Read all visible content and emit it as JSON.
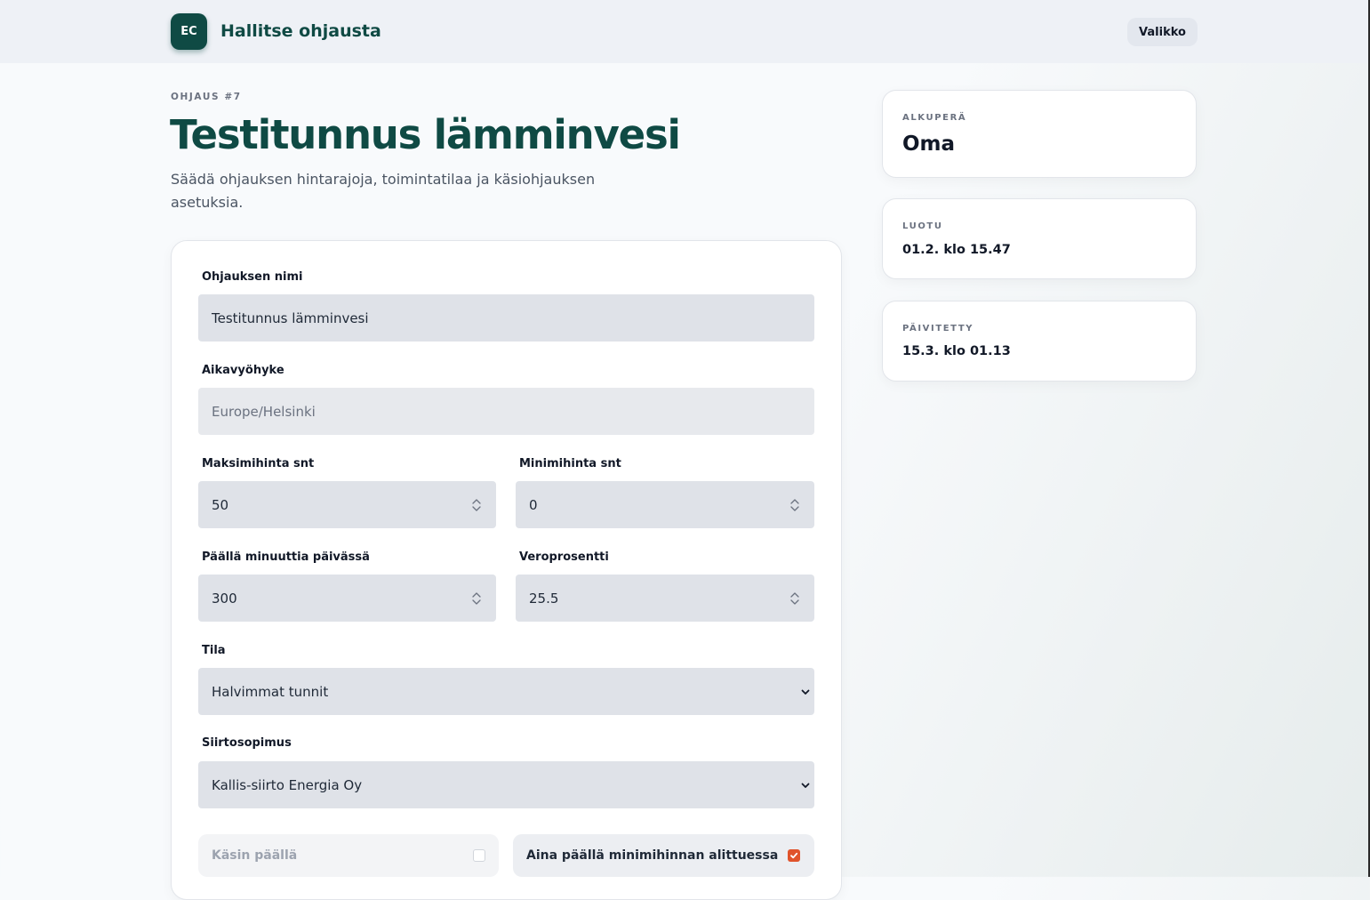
{
  "app": {
    "logo_text": "EC",
    "title": "Hallitse ohjausta",
    "menu_label": "Valikko"
  },
  "page": {
    "eyebrow": "OHJAUS #7",
    "title": "Testitunnus lämminvesi",
    "subtitle": "Säädä ohjauksen hintarajoja, toimintatilaa ja käsiohjauksen asetuksia."
  },
  "form": {
    "name": {
      "label": "Ohjauksen nimi",
      "value": "Testitunnus lämminvesi"
    },
    "timezone": {
      "label": "Aikavyöhyke",
      "value": "Europe/Helsinki"
    },
    "max_price": {
      "label": "Maksimihinta snt",
      "value": "50"
    },
    "min_price": {
      "label": "Minimihinta snt",
      "value": "0"
    },
    "minutes_on": {
      "label": "Päällä minuuttia päivässä",
      "value": "300"
    },
    "tax": {
      "label": "Veroprosentti",
      "value": "25.5"
    },
    "mode": {
      "label": "Tila",
      "value": "Halvimmat tunnit"
    },
    "contract": {
      "label": "Siirtosopimus",
      "value": "Kallis-siirto Energia Oy"
    },
    "manual_on": {
      "label": "Käsin päällä",
      "checked": false
    },
    "always_on_below_min": {
      "label": "Aina päällä minimihinnan alittuessa",
      "checked": true
    }
  },
  "sidebar": {
    "origin": {
      "label": "ALKUPERÄ",
      "value": "Oma"
    },
    "created": {
      "label": "LUOTU",
      "value": "01.2. klo 15.47"
    },
    "updated": {
      "label": "PÄIVITETTY",
      "value": "15.3. klo 01.13"
    }
  },
  "colors": {
    "brand": "#0f4a44",
    "accent": "#e0532b",
    "field_bg": "#dfe2e8"
  }
}
